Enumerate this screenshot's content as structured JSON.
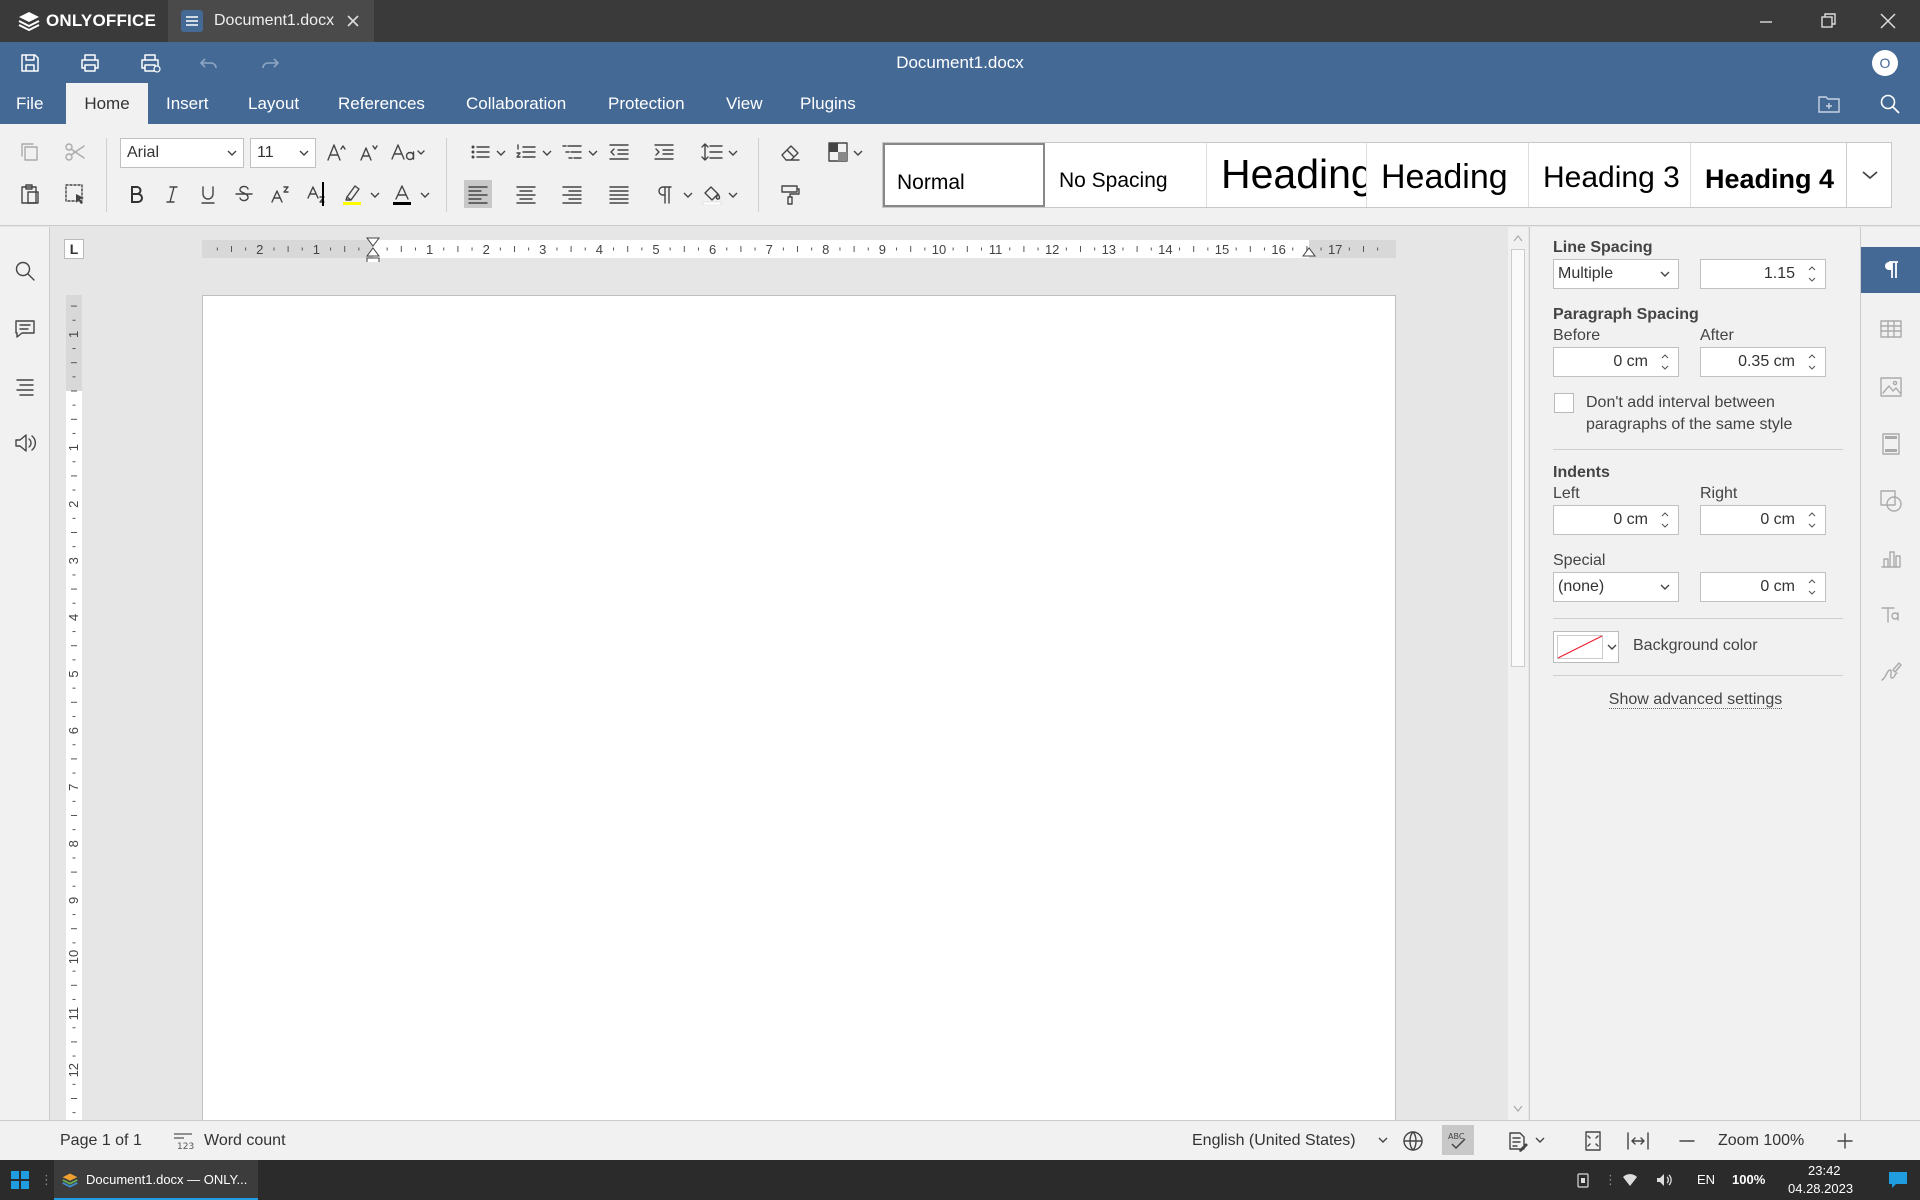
{
  "app": {
    "name": "ONLYOFFICE",
    "tab_label": "Document1.docx",
    "document_title": "Document1.docx",
    "avatar_initial": "O"
  },
  "menu": {
    "tabs": [
      "File",
      "Home",
      "Insert",
      "Layout",
      "References",
      "Collaboration",
      "Protection",
      "View",
      "Plugins"
    ],
    "active": "Home"
  },
  "font": {
    "family": "Arial",
    "size": "11"
  },
  "styles": {
    "items": [
      "Normal",
      "No Spacing",
      "Heading",
      "Heading",
      "Heading 3",
      "Heading 4"
    ],
    "selected": "Normal"
  },
  "ruler": {
    "h_left": [
      "2",
      "1"
    ],
    "h_right": [
      "1",
      "2",
      "3",
      "4",
      "5",
      "6",
      "7",
      "8",
      "9",
      "10",
      "11",
      "12",
      "13",
      "14",
      "15",
      "16",
      "17"
    ],
    "v_top": [
      "1"
    ],
    "v_body": [
      "1",
      "2",
      "3",
      "4",
      "5",
      "6",
      "7",
      "8",
      "9",
      "10",
      "11",
      "12"
    ],
    "tab_marker": "L"
  },
  "paragraph_panel": {
    "line_spacing": {
      "label": "Line Spacing",
      "mode": "Multiple",
      "value": "1.15"
    },
    "paragraph_spacing": {
      "label": "Paragraph Spacing",
      "before_label": "Before",
      "before": "0 cm",
      "after_label": "After",
      "after": "0.35 cm"
    },
    "no_interval": {
      "line1": "Don't add interval between",
      "line2": "paragraphs of the same style",
      "checked": false
    },
    "indents": {
      "label": "Indents",
      "left_label": "Left",
      "left": "0 cm",
      "right_label": "Right",
      "right": "0 cm",
      "special_label": "Special",
      "special": "(none)",
      "special_value": "0 cm"
    },
    "background": {
      "label": "Background color"
    },
    "advanced_link": "Show advanced settings"
  },
  "status": {
    "page": "Page 1 of 1",
    "word_count": "Word count",
    "language": "English (United States)",
    "zoom": "Zoom 100%"
  },
  "taskbar": {
    "app_label": "Document1.docx — ONLY...",
    "lang": "EN",
    "battery": "100%",
    "time": "23:42",
    "date": "04.28.2023"
  },
  "colors": {
    "header": "#446995",
    "titlebar": "#3a3a3a",
    "highlight": "#ffff00",
    "font_color": "#000000",
    "accent": "#1f9de0"
  }
}
